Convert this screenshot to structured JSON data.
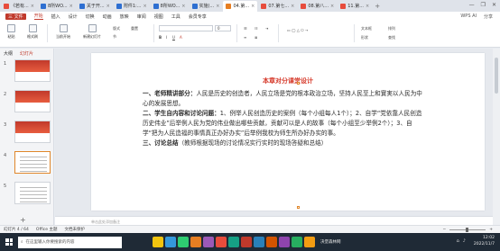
{
  "tabs": [
    {
      "label": "《若有...",
      "color": "#e74c3c"
    },
    {
      "label": "8所WO...",
      "color": "#2e6fd1"
    },
    {
      "label": "关于开...",
      "color": "#2e6fd1"
    },
    {
      "label": "附件1:...",
      "color": "#2e6fd1"
    },
    {
      "label": "8所WO...",
      "color": "#2e6fd1"
    },
    {
      "label": "实施(...",
      "color": "#2e6fd1"
    },
    {
      "label": "04.第...",
      "color": "#e67e22",
      "active": true
    },
    {
      "label": "07.第七...",
      "color": "#e74c3c"
    },
    {
      "label": "08.第八...",
      "color": "#e74c3c"
    },
    {
      "label": "11.第...",
      "color": "#e74c3c"
    }
  ],
  "window_controls": {
    "min": "—",
    "max": "❐",
    "close": "✕"
  },
  "menu": {
    "file": "三 文件",
    "items": [
      "开始",
      "插入",
      "设计",
      "切换",
      "动画",
      "放映",
      "审阅",
      "视图",
      "工具",
      "会员专享"
    ],
    "selected": "开始",
    "right": [
      "WPS AI",
      "分享"
    ]
  },
  "toolbar": {
    "paste": "粘贴",
    "format_painter": "格式刷",
    "current_slide": "当前开始",
    "new_slide": "新建幻灯片",
    "layout": "版式",
    "section": "节",
    "reset": "重置",
    "font_name": "",
    "font_size": "0",
    "textbox": "文本框",
    "shape": "形状",
    "arrange": "排列",
    "find": "查找"
  },
  "left_pane": {
    "tabs": [
      "大纲",
      "幻灯片"
    ],
    "active": "幻灯片",
    "slide_numbers": [
      "1",
      "2",
      "3",
      "4",
      "5"
    ],
    "selected": "4"
  },
  "slide": {
    "title": "本章对分课堂设计",
    "sections": [
      {
        "head": "一、老师精讲部分：",
        "text": "人民是历史的创造者，人民立场是党的根本政治立场，坚持人民至上和實実以人民为中心的发展思想。"
      },
      {
        "head": "二、学生自内容和讨论问题：",
        "text": "1、例举人民创造历史的案例（每个小组每人1个）；2、自学“党依靠人民创造历史伟业”后举例人民为党的伟业做出哪些贡献，贡献可以是人的故事（每个小组至少举例2个）；3、自学“把为人民造福的事情真正办好办实”后举例我校为师生所办好办实的事。"
      },
      {
        "head": "三、讨论总结",
        "text": "（教师根据现场的讨论情况实行实时的现场答疑和总结）"
      }
    ]
  },
  "notes_placeholder": "单击此处添加备注",
  "status": {
    "slide_info": "幻灯片 4 / 64",
    "theme": "Office 主题",
    "doc_state": "文档未保护",
    "zoom": "+"
  },
  "taskbar": {
    "search_placeholder": "在这里输入你要搜索的内容",
    "weather": "决堡森林网",
    "time": "12:02",
    "date": "2022/11/7"
  },
  "taskbar_apps": [
    "#f1c40f",
    "#3498db",
    "#2ecc71",
    "#e67e22",
    "#9b59b6",
    "#e74c3c",
    "#16a085",
    "#c0392b",
    "#2980b9",
    "#d35400",
    "#8e44ad",
    "#27ae60",
    "#f39c12"
  ]
}
